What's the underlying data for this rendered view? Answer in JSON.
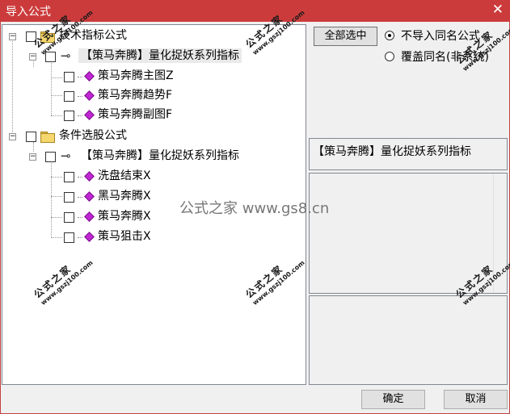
{
  "window": {
    "title": "导入公式",
    "close_glyph": "✕"
  },
  "tree": {
    "groups": [
      {
        "label": "技术指标公式",
        "folder": {
          "label": "【策马奔腾】量化捉妖系列指标",
          "items": [
            "策马奔腾主图Z",
            "策马奔腾趋势F",
            "策马奔腾副图F"
          ]
        }
      },
      {
        "label": "条件选股公式",
        "folder": {
          "label": "【策马奔腾】量化捉妖系列指标",
          "items": [
            "洗盘结束X",
            "黑马奔腾X",
            "策马奔腾X",
            "策马狙击X"
          ]
        }
      }
    ],
    "expander_glyph": "−",
    "key_glyph": "⊸"
  },
  "controls": {
    "select_all": "全部选中",
    "radio_skip": "不导入同名公式",
    "radio_overwrite": "覆盖同名(非系统)",
    "radio_selected": "skip"
  },
  "detail": {
    "name": "【策马奔腾】量化捉妖系列指标"
  },
  "footer": {
    "ok": "确定",
    "cancel": "取消"
  },
  "watermark": {
    "brand": "公式之家",
    "url": "www.gszj100.com",
    "center": "公式之家 www.gs8.cn"
  },
  "colors": {
    "titlebar": "#cc3b3b",
    "diamond": "#c026d3",
    "folder": "#f5d76e"
  }
}
